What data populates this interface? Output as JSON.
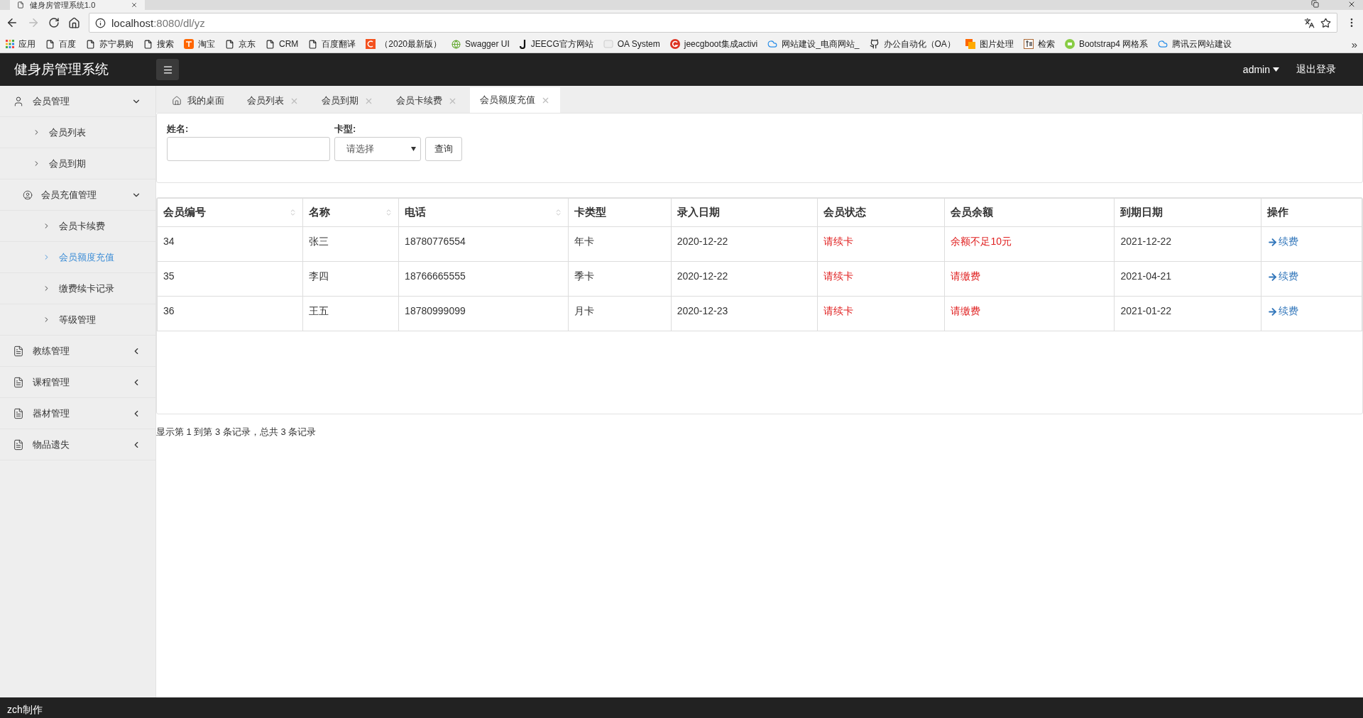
{
  "browser": {
    "tab_title": "健身房管理系统1.0",
    "url_host": "localhost",
    "url_rest": ":8080/dl/yz",
    "bookmarks": [
      {
        "kind": "apps",
        "label": "应用"
      },
      {
        "kind": "page",
        "label": "百度"
      },
      {
        "kind": "page",
        "label": "苏宁易购"
      },
      {
        "kind": "page",
        "label": "搜索"
      },
      {
        "kind": "taobao",
        "label": "淘宝"
      },
      {
        "kind": "page",
        "label": "京东"
      },
      {
        "kind": "page",
        "label": "CRM"
      },
      {
        "kind": "page",
        "label": "百度翻译"
      },
      {
        "kind": "c",
        "label": "（2020最新版）"
      },
      {
        "kind": "globe",
        "label": "Swagger UI"
      },
      {
        "kind": "j",
        "label": "JEECG官方网站"
      },
      {
        "kind": "oa",
        "label": "OA System"
      },
      {
        "kind": "g",
        "label": "jeecgboot集成activi"
      },
      {
        "kind": "cloud",
        "label": "网站建设_电商网站_"
      },
      {
        "kind": "github",
        "label": "办公自动化（OA）"
      },
      {
        "kind": "image",
        "label": "图片处理"
      },
      {
        "kind": "zhi",
        "label": "检索"
      },
      {
        "kind": "boot",
        "label": "Bootstrap4 网格系"
      },
      {
        "kind": "cloud",
        "label": "腾讯云网站建设"
      }
    ],
    "overflow": "»"
  },
  "header": {
    "title": "健身房管理系统",
    "user": "admin",
    "logout": "退出登录"
  },
  "sidebar": {
    "items": [
      {
        "kind": "user",
        "label": "会员管理",
        "expanded": true,
        "children": [
          {
            "label": "会员列表",
            "selected": false
          },
          {
            "label": "会员到期",
            "selected": false
          },
          {
            "kind": "user-circle",
            "label": "会员充值管理",
            "expanded": true,
            "children": [
              {
                "label": "会员卡续费",
                "selected": false
              },
              {
                "label": "会员额度充值",
                "selected": true
              },
              {
                "label": "缴费续卡记录",
                "selected": false
              },
              {
                "label": "等级管理",
                "selected": false
              }
            ]
          }
        ]
      },
      {
        "kind": "doc",
        "label": "教练管理",
        "expanded": false
      },
      {
        "kind": "doc",
        "label": "课程管理",
        "expanded": false
      },
      {
        "kind": "doc",
        "label": "器材管理",
        "expanded": false
      },
      {
        "kind": "doc",
        "label": "物品遗失",
        "expanded": false
      }
    ]
  },
  "tabs": [
    {
      "label": "我的桌面",
      "home": true,
      "closable": false,
      "selected": false
    },
    {
      "label": "会员列表",
      "closable": true,
      "selected": false
    },
    {
      "label": "会员到期",
      "closable": true,
      "selected": false
    },
    {
      "label": "会员卡续费",
      "closable": true,
      "selected": false
    },
    {
      "label": "会员额度充值",
      "closable": true,
      "selected": true
    }
  ],
  "search": {
    "name_label": "姓名:",
    "card_label": "卡型:",
    "card_placeholder": "请选择",
    "button": "查询"
  },
  "table": {
    "columns": [
      {
        "label": "会员编号",
        "sortable": true,
        "kind": "text"
      },
      {
        "label": "名称",
        "sortable": true,
        "kind": "text"
      },
      {
        "label": "电话",
        "sortable": true,
        "kind": "text"
      },
      {
        "label": "卡类型",
        "sortable": false,
        "kind": "text"
      },
      {
        "label": "录入日期",
        "sortable": false,
        "kind": "text"
      },
      {
        "label": "会员状态",
        "sortable": false,
        "kind": "alert"
      },
      {
        "label": "会员余额",
        "sortable": false,
        "kind": "alert"
      },
      {
        "label": "到期日期",
        "sortable": false,
        "kind": "text"
      },
      {
        "label": "操作",
        "sortable": false,
        "kind": "action"
      }
    ],
    "rows": [
      [
        "34",
        "张三",
        "18780776554",
        "年卡",
        "2020-12-22",
        "请续卡",
        "余额不足10元",
        "2021-12-22",
        "续费"
      ],
      [
        "35",
        "李四",
        "18766665555",
        "季卡",
        "2020-12-22",
        "请续卡",
        "请缴费",
        "2021-04-21",
        "续费"
      ],
      [
        "36",
        "王五",
        "18780999099",
        "月卡",
        "2020-12-23",
        "请续卡",
        "请缴费",
        "2021-01-22",
        "续费"
      ]
    ]
  },
  "pagination": "显示第 1 到第 3 条记录，总共 3 条记录",
  "footer": "zch制作"
}
